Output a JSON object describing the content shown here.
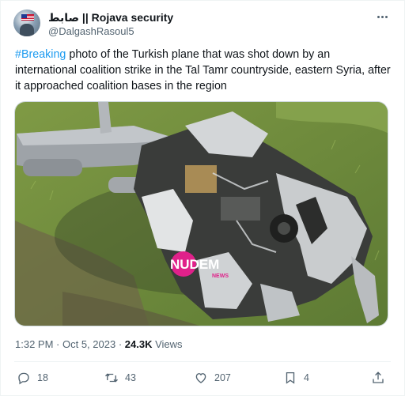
{
  "tweet": {
    "display_name": "صابط || Rojava security",
    "handle": "@DalgashRasoul5",
    "hashtag": "#Breaking",
    "text": " photo of the Turkish plane that was shot down by an international coalition strike in the Tal Tamr countryside, eastern Syria, after it approached coalition bases in the region",
    "media": {
      "watermark": "NUDEM",
      "watermark_sub": "NEWS"
    },
    "time": "1:32 PM",
    "sep1": " · ",
    "date": "Oct 5, 2023",
    "sep2": " · ",
    "views_count": "24.3K",
    "views_label": " Views"
  },
  "actions": {
    "reply": {
      "icon": "reply-icon",
      "count": "18"
    },
    "retweet": {
      "icon": "retweet-icon",
      "count": "43"
    },
    "like": {
      "icon": "like-icon",
      "count": "207"
    },
    "bookmark": {
      "icon": "bookmark-icon",
      "count": "4"
    },
    "share": {
      "icon": "share-icon"
    }
  },
  "colors": {
    "link": "#1d9bf0",
    "muted": "#536471",
    "text": "#0f1419",
    "watermark": "#e0218a"
  }
}
